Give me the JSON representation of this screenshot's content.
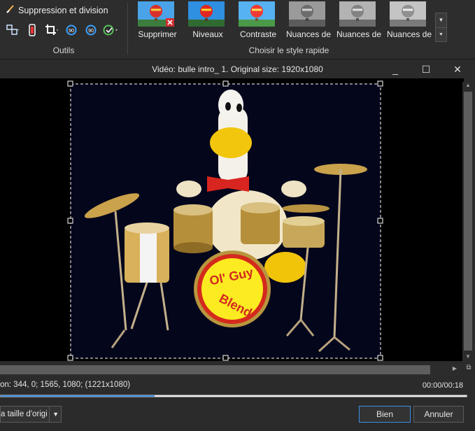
{
  "toolbar": {
    "split_label": "Suppression et division",
    "tools_group_label": "Outils",
    "styles_group_label": "Choisir le style rapide",
    "style_items": [
      {
        "label": "Supprimer"
      },
      {
        "label": "Niveaux"
      },
      {
        "label": "Contraste"
      },
      {
        "label": "Nuances de"
      },
      {
        "label": "Nuances de"
      },
      {
        "label": "Nuances de"
      }
    ]
  },
  "window": {
    "title": "Vidéo: bulle intro_ 1. Original size: 1920x1080",
    "minimize": "_",
    "maximize": "☐",
    "close": "✕"
  },
  "drum_logo": {
    "top": "Ol' Guy",
    "bottom": "Blend"
  },
  "status": {
    "position_text": "on:  344, 0; 1565, 1080; (1221x1080)",
    "timecode": "00:00/00:18",
    "progress_fraction": 0.33
  },
  "footer": {
    "size_select": "a taille d'origin",
    "ok_label": "Bien",
    "cancel_label": "Annuler"
  },
  "colors": {
    "accent": "#3d8ee6",
    "background": "#2b2b2b"
  }
}
